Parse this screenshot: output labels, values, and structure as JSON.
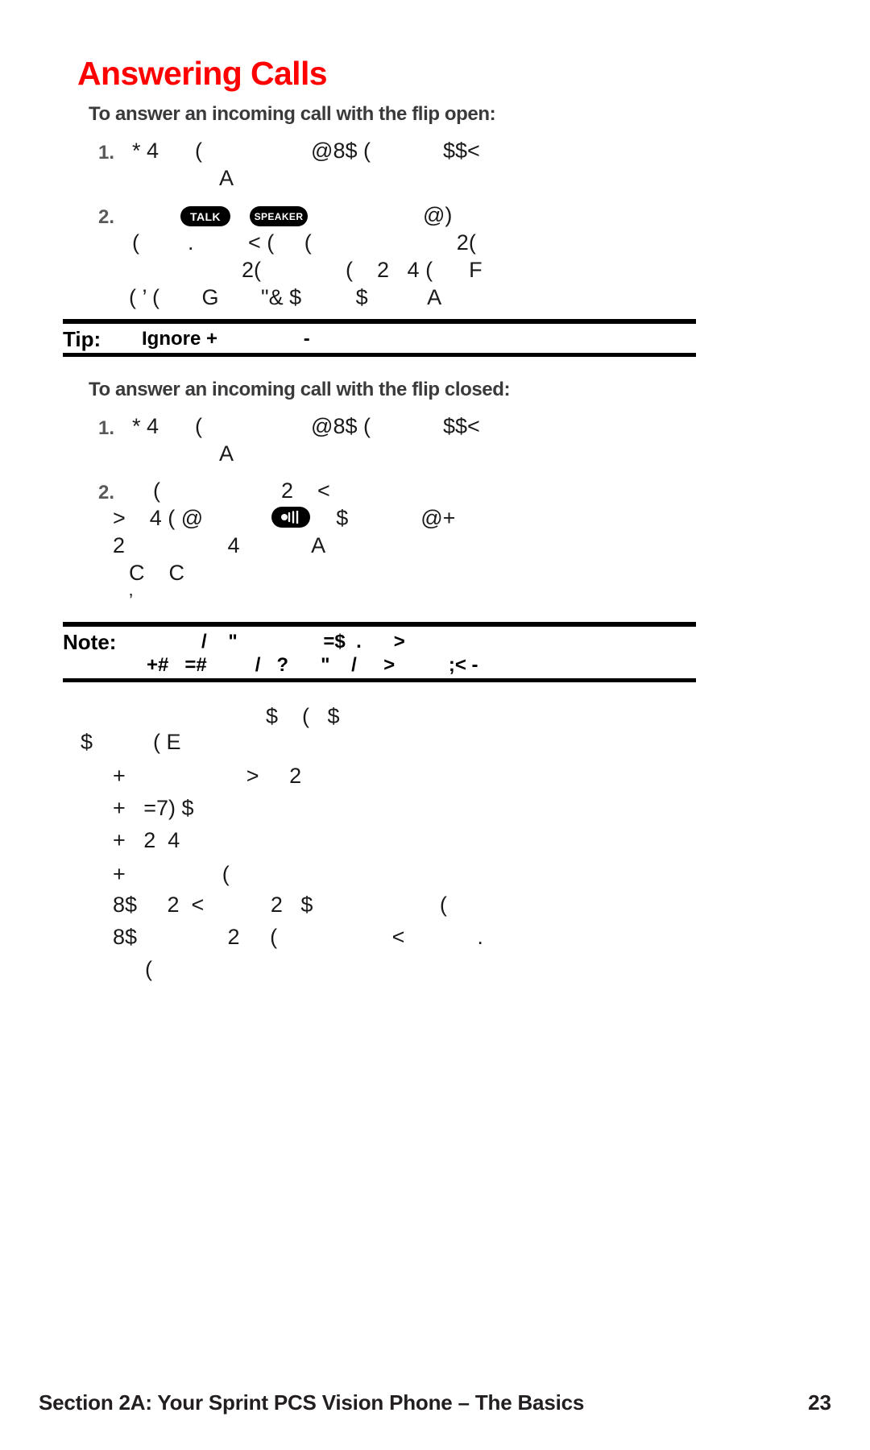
{
  "document": {
    "title": "Answering Calls",
    "title_color": "#ff0000"
  },
  "sections": [
    {
      "heading": "To answer an incoming call with the flip open:",
      "steps": [
        {
          "number": "1.",
          "lines": [
            "* 4      (                  @8$ (            $$<",
            "A"
          ]
        },
        {
          "number": "2.",
          "lines": [
            "@)",
            "(        .         < (     (                        2(",
            "2(              (    2   4 (      F",
            "( ’ (       G       \"& $         $          A"
          ]
        }
      ]
    },
    {
      "heading": "To answer an incoming call with the flip closed:",
      "steps": [
        {
          "number": "1.",
          "lines": [
            "* 4      (                  @8$ (            $$<",
            "A"
          ]
        },
        {
          "number": "2.",
          "lines": [
            "(                    2    <",
            ">    4 ( @                      $            @+",
            "2                 4            A",
            "C    C",
            "’"
          ]
        }
      ]
    }
  ],
  "keycaps": {
    "talk": "TALK",
    "speaker": "SPEAKER",
    "speaker_icon": "speaker-volume-icon"
  },
  "callouts": [
    {
      "label": "Tip:",
      "text": "Ignore +                -"
    },
    {
      "label": "Note:",
      "lines": [
        "/    \"                =$  .      >",
        "+#   =#         /   ?      \"    /     >          ;< -"
      ]
    }
  ],
  "trailing_block": {
    "lines": [
      "$    (   $",
      "$          ( E",
      "+                    >     2",
      "+   =7) $",
      "+   2  4",
      "+                (",
      "8$     2  <           2   $                     (",
      "8$               2     (                   <            .",
      "("
    ]
  },
  "footer": {
    "section_label": "Section 2A: Your Sprint PCS Vision Phone – The Basics",
    "page_number": "23"
  }
}
